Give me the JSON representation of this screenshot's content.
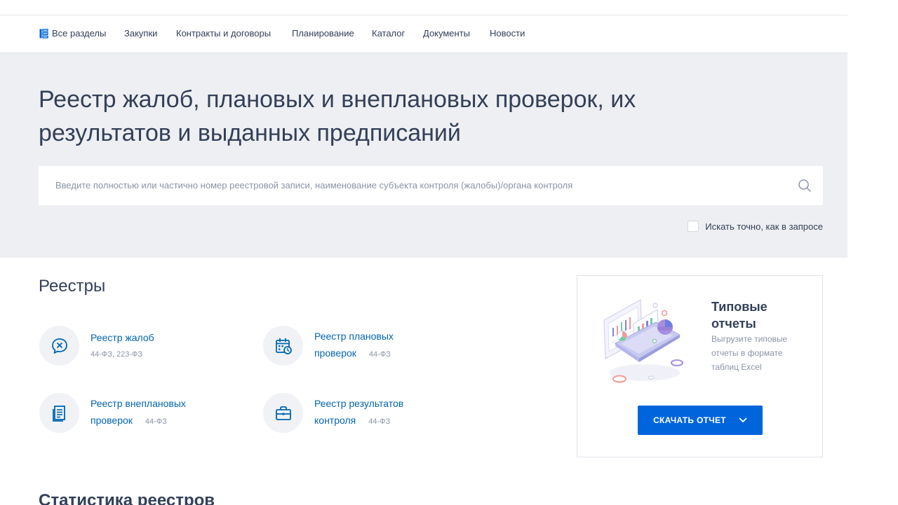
{
  "nav": {
    "all_sections": "Все разделы",
    "items": [
      "Закупки",
      "Контракты и договоры",
      "Планирование",
      "Каталог",
      "Документы",
      "Новости"
    ]
  },
  "hero": {
    "title": "Реестр жалоб, плановых и внеплановых проверок, их результатов и выданных предписаний",
    "search_placeholder": "Введите полностью или частично номер реестровой записи, наименование субъекта контроля (жалобы)/органа контроля",
    "exact_label": "Искать точно, как в запросе",
    "exact_checked": false
  },
  "registries": {
    "title": "Реестры",
    "items": [
      {
        "icon": "complaint-icon",
        "label": "Реестр жалоб",
        "law": "44-ФЗ, 223-ФЗ"
      },
      {
        "icon": "calendar-icon",
        "label_line1": "Реестр плановых",
        "label_line2": "проверок",
        "law": "44-ФЗ"
      },
      {
        "icon": "document-list-icon",
        "label_line1": "Реестр внеплановых",
        "label_line2": "проверок",
        "law": "44-ФЗ"
      },
      {
        "icon": "briefcase-icon",
        "label_line1": "Реестр результатов",
        "label_line2": "контроля",
        "law": "44-ФЗ"
      }
    ]
  },
  "reports": {
    "title": "Типовые отчеты",
    "description": "Выгрузите типовые отчеты в формате таблиц Excel",
    "button_label": "СКАЧАТЬ ОТЧЕТ"
  },
  "stats": {
    "title": "Статистика реестров"
  },
  "colors": {
    "accent": "#0065dd",
    "link": "#0065b1",
    "text": "#334059",
    "hero_bg": "#eeeff2"
  }
}
